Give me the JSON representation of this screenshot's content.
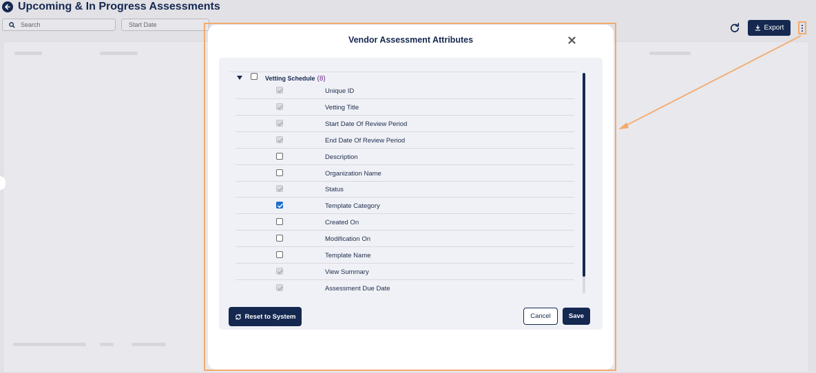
{
  "page": {
    "title": "Upcoming & In Progress Assessments",
    "search_placeholder": "Search",
    "start_date_placeholder": "Start Date"
  },
  "toolbar": {
    "export_label": "Export"
  },
  "modal": {
    "title": "Vendor Assessment Attributes",
    "group": {
      "label": "Vetting Schedule",
      "count": "(8)",
      "checked": false,
      "expanded": true
    },
    "attributes": [
      {
        "label": "Unique ID",
        "state": "checked-disabled"
      },
      {
        "label": "Vetting Title",
        "state": "checked-disabled"
      },
      {
        "label": "Start Date Of Review Period",
        "state": "checked-disabled"
      },
      {
        "label": "End Date Of Review Period",
        "state": "checked-disabled"
      },
      {
        "label": "Description",
        "state": "unchecked"
      },
      {
        "label": "Organization Name",
        "state": "unchecked"
      },
      {
        "label": "Status",
        "state": "checked-disabled"
      },
      {
        "label": "Template Category",
        "state": "checked"
      },
      {
        "label": "Created On",
        "state": "unchecked"
      },
      {
        "label": "Modification On",
        "state": "unchecked"
      },
      {
        "label": "Template Name",
        "state": "unchecked"
      },
      {
        "label": "View Summary",
        "state": "checked-disabled"
      },
      {
        "label": "Assessment Due Date",
        "state": "checked-disabled"
      }
    ],
    "reset_label": "Reset to System",
    "cancel_label": "Cancel",
    "save_label": "Save"
  },
  "colors": {
    "primary": "#142850",
    "highlight": "#f4a96a",
    "checkbox_checked": "#1a6fd1"
  }
}
